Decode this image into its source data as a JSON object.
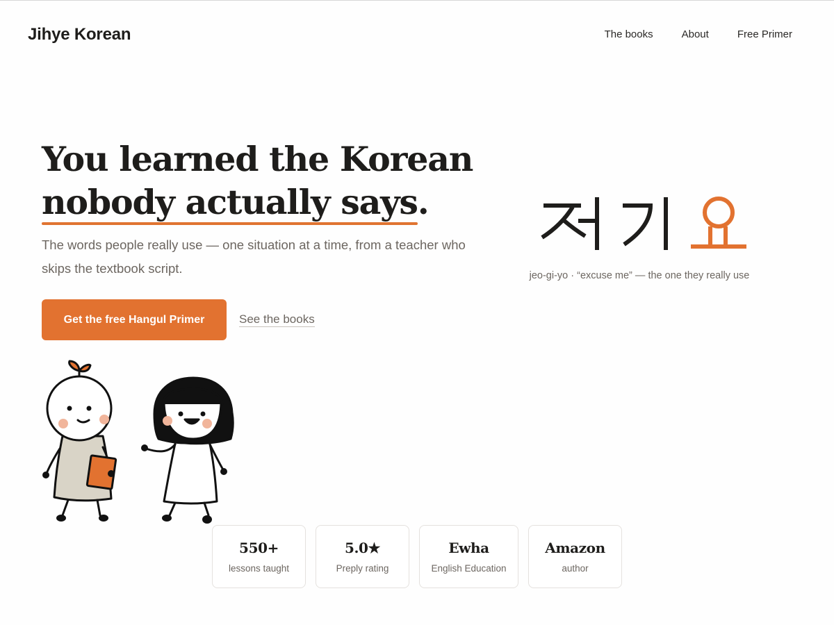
{
  "brand": {
    "name": "Jihye Korean"
  },
  "nav": {
    "items": [
      "The books",
      "About",
      "Free Primer"
    ]
  },
  "hero": {
    "headline_line1": "You learned the Korean",
    "headline_line2_underlined": "nobody actually says",
    "headline_line2_end": ".",
    "subtext": "The words people really use — one situation at a time, from a teacher who skips the textbook script.",
    "cta_label": "Get the free Hangul Primer",
    "secondary_link": "See the books"
  },
  "word": {
    "romanization": "jeo-gi-yo · “excuse me” — the one they really use"
  },
  "stats": [
    {
      "value": "550+",
      "label": "lessons taught"
    },
    {
      "value": "5.0★",
      "label": "Preply rating"
    },
    {
      "value": "Ewha",
      "label": "English Education"
    },
    {
      "value": "Amazon",
      "label": "author"
    }
  ],
  "colors": {
    "accent": "#e27230",
    "text": "#1e1d1b",
    "muted": "#6c6660"
  }
}
